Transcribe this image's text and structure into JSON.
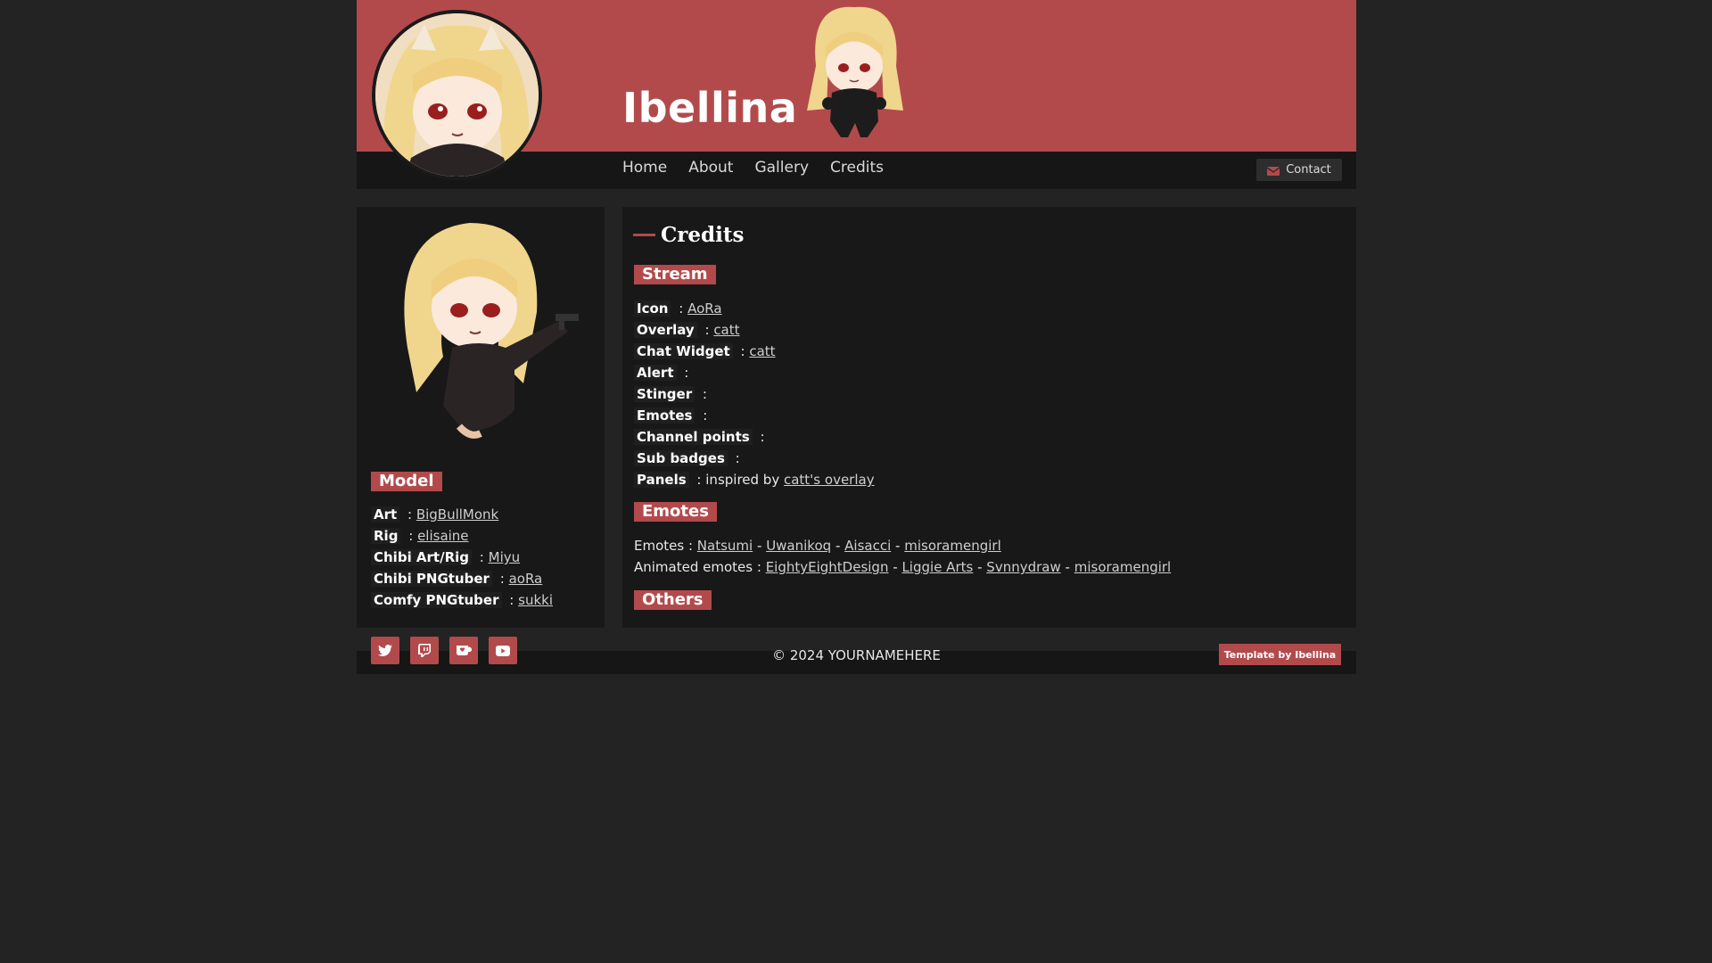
{
  "site": {
    "title": "Ibellina"
  },
  "nav": {
    "items": [
      "Home",
      "About",
      "Gallery",
      "Credits"
    ],
    "contact": "Contact"
  },
  "sidebar": {
    "section": "Model",
    "credits": [
      {
        "key": "Art",
        "sep": ":",
        "links": [
          "BigBullMonk"
        ]
      },
      {
        "key": "Rig",
        "sep": ":",
        "links": [
          "elisaine"
        ]
      },
      {
        "key": "Chibi Art/Rig",
        "sep": ":",
        "links": [
          "Miyu"
        ]
      },
      {
        "key": "Chibi PNGtuber",
        "sep": ":",
        "links": [
          "aoRa"
        ]
      },
      {
        "key": "Comfy PNGtuber",
        "sep": ":",
        "links": [
          "sukki"
        ]
      }
    ]
  },
  "main": {
    "title": "Credits",
    "stream": {
      "label": "Stream",
      "rows": [
        {
          "key": "Icon",
          "sep": ":",
          "link": "AoRa"
        },
        {
          "key": "Overlay",
          "sep": ":",
          "link": "catt"
        },
        {
          "key": "Chat Widget",
          "sep": ":",
          "link": "catt"
        },
        {
          "key": "Alert",
          "sep": ":"
        },
        {
          "key": "Stinger",
          "sep": ":"
        },
        {
          "key": "Emotes",
          "sep": ":"
        },
        {
          "key": "Channel points",
          "sep": ":"
        },
        {
          "key": "Sub badges",
          "sep": ":"
        },
        {
          "key": "Panels",
          "sep": ":",
          "text": "inspired by",
          "link": "catt's overlay"
        }
      ]
    },
    "emotes": {
      "label": "Emotes",
      "static_prefix": "Emotes :",
      "static": [
        "Natsumi",
        "Uwanikoq",
        "Aisacci",
        "misoramengirl"
      ],
      "animated_prefix": "Animated emotes :",
      "animated": [
        "EightyEightDesign",
        "Liggie Arts",
        "Svnnydraw",
        "misoramengirl"
      ],
      "separator": "-"
    },
    "others": {
      "label": "Others"
    }
  },
  "footer": {
    "social_icons": [
      "twitter-icon",
      "twitch-icon",
      "kofi-icon",
      "youtube-icon"
    ],
    "copyright": "© 2024 YOURNAMEHERE",
    "template_credit": "Template by Ibellina"
  },
  "colors": {
    "accent": "#b24a4c",
    "background": "#232323",
    "panel": "#181818",
    "bar": "#161616"
  }
}
